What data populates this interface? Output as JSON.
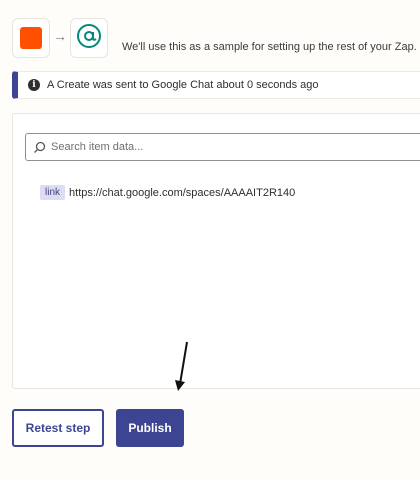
{
  "header": {
    "trigger_app_icon": "orange-square-icon",
    "action_app_icon": "google-chat-icon",
    "arrow_icon": "arrow-right-icon",
    "sample_message": "We'll use this as a sample for setting up the rest of your Zap."
  },
  "banner": {
    "icon": "info-icon",
    "message": "A Create was sent to Google Chat about 0 seconds ago",
    "accent_color": "#3d4592"
  },
  "data_panel": {
    "search": {
      "placeholder": "Search item data...",
      "value": ""
    },
    "items": [
      {
        "key": "link",
        "value": "https://chat.google.com/spaces/AAAAIT2R140"
      }
    ]
  },
  "actions": {
    "retest_label": "Retest step",
    "publish_label": "Publish"
  },
  "colors": {
    "brand_orange": "#ff4f00",
    "primary": "#3d4592",
    "google_chat_green": "#00897b"
  }
}
